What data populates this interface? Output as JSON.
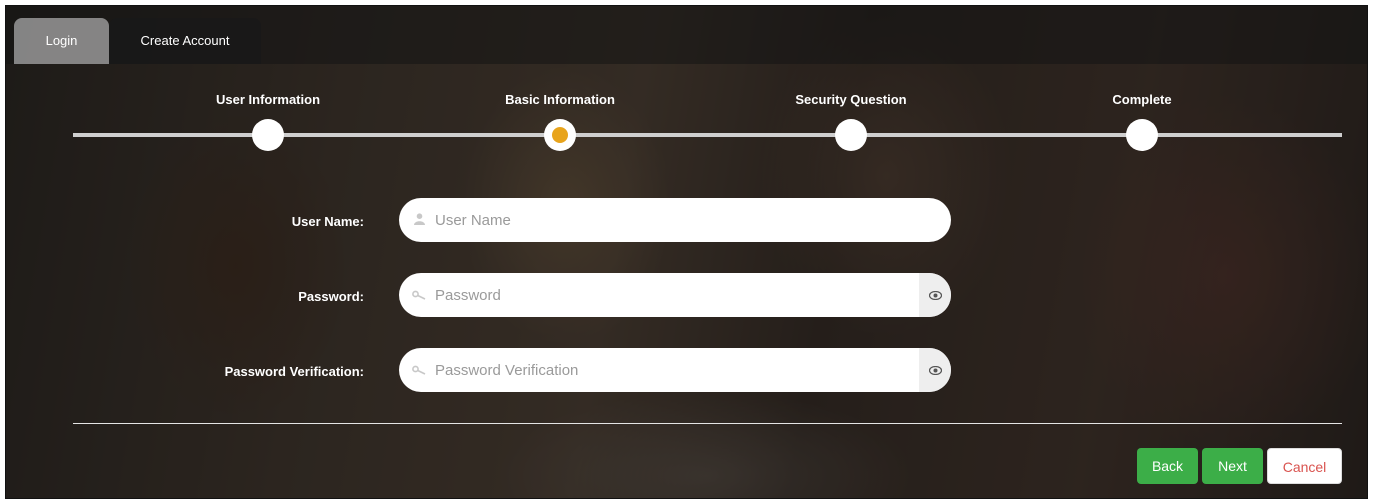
{
  "tabs": [
    {
      "label": "Login"
    },
    {
      "label": "Create Account"
    }
  ],
  "steps": [
    {
      "label": "User Information",
      "state": "done"
    },
    {
      "label": "Basic Information",
      "state": "active"
    },
    {
      "label": "Security Question",
      "state": "pending"
    },
    {
      "label": "Complete",
      "state": "pending"
    }
  ],
  "form": {
    "username": {
      "label": "User Name:",
      "placeholder": "User Name",
      "icon": "user-icon"
    },
    "password": {
      "label": "Password:",
      "placeholder": "Password",
      "icon": "key-icon",
      "toggle_icon": "eye-icon"
    },
    "password_verification": {
      "label": "Password Verification:",
      "placeholder": "Password Verification",
      "icon": "key-icon",
      "toggle_icon": "eye-icon"
    }
  },
  "buttons": {
    "back": "Back",
    "next": "Next",
    "cancel": "Cancel"
  },
  "colors": {
    "active_step": "#e8a41c",
    "primary_button": "#3cae48",
    "cancel_text": "#d9534f"
  }
}
